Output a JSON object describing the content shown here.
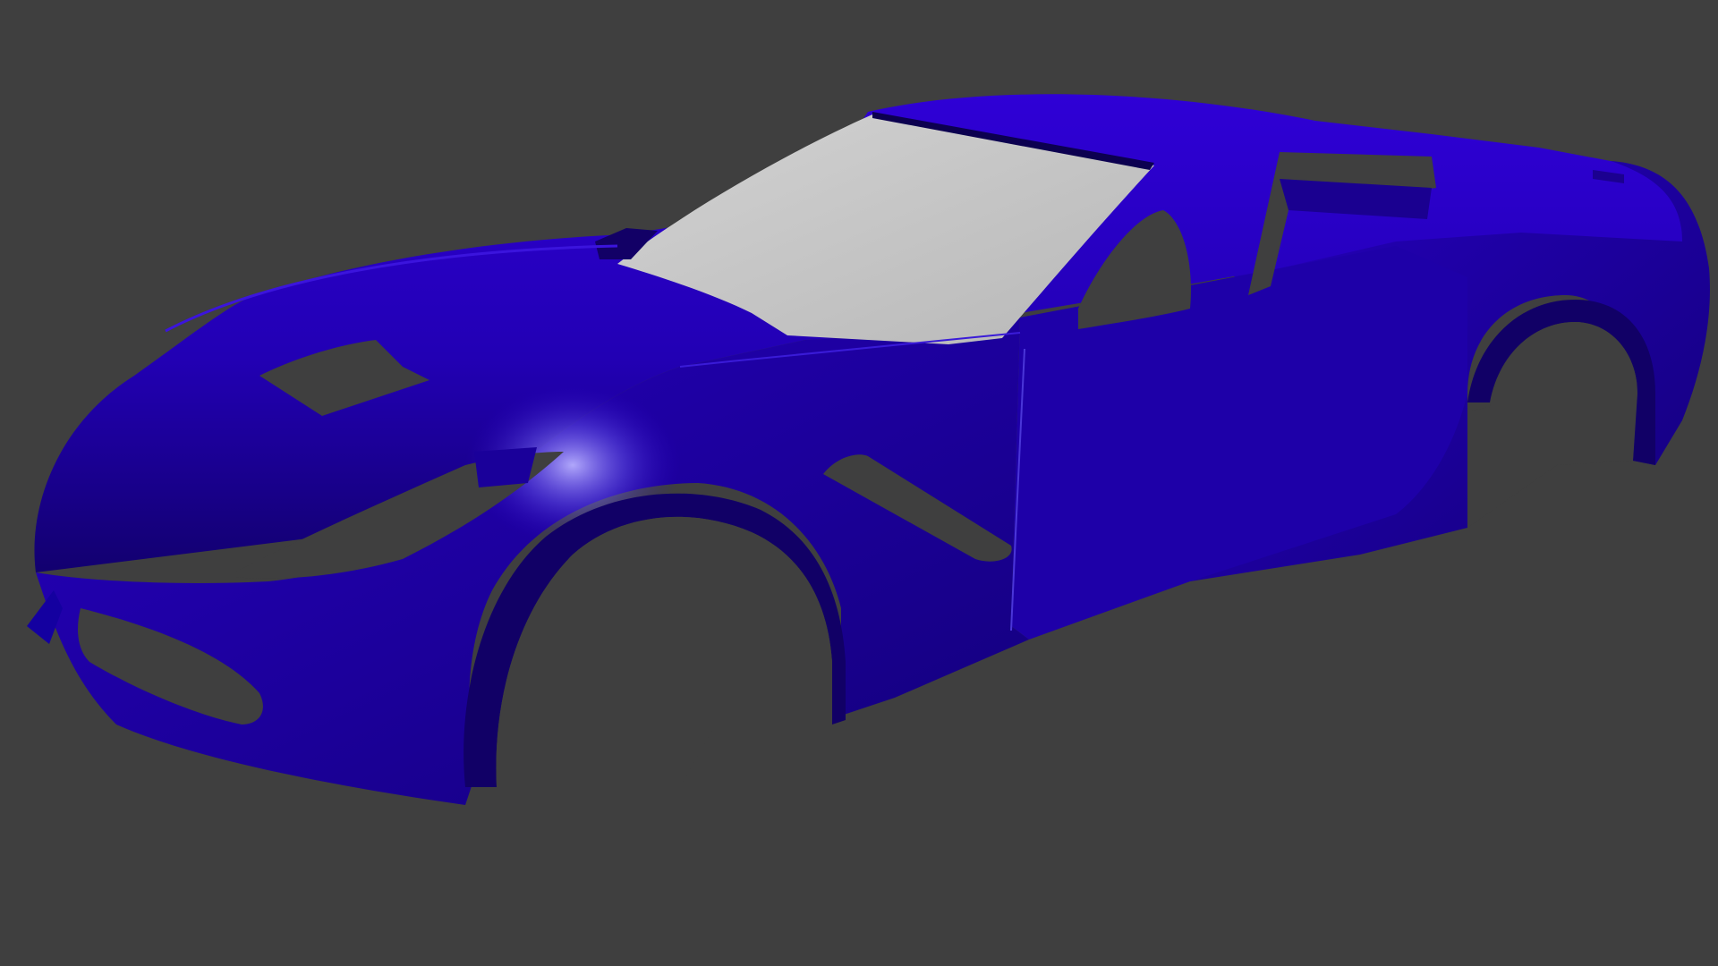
{
  "viewport": {
    "background_color": "#3f3f3f",
    "content": "3d-render-car-body-shell"
  },
  "car": {
    "body_color": "#2a00c8",
    "body_shadow_color": "#14007a",
    "body_highlight_color": "#8a7cff",
    "glass_color": "#c4c4c4"
  }
}
